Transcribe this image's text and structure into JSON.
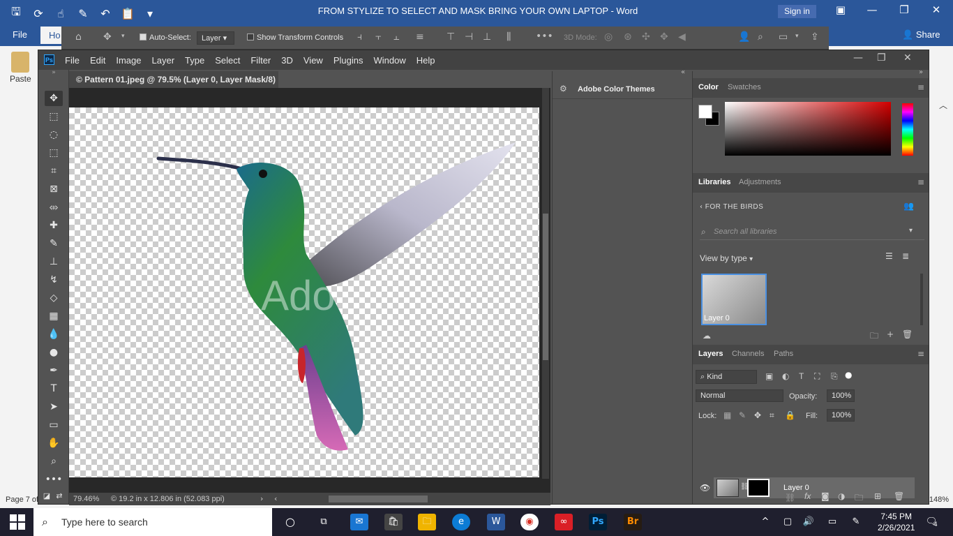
{
  "word": {
    "doc_title": "FROM STYLIZE TO SELECT AND MASK BRING YOUR OWN LAPTOP  -  Word",
    "sign_in": "Sign in",
    "file_tab": "File",
    "home_tab": "Ho",
    "share": "Share",
    "paste": "Paste",
    "page_status": "Page 7 of",
    "zoom": "148%"
  },
  "ps": {
    "menus": [
      "File",
      "Edit",
      "Image",
      "Layer",
      "Type",
      "Select",
      "Filter",
      "3D",
      "View",
      "Plugins",
      "Window",
      "Help"
    ],
    "logo": "Ps",
    "options": {
      "auto_select_label": "Auto-Select:",
      "auto_select_checked": true,
      "auto_select_target": "Layer",
      "show_transform_label": "Show Transform Controls",
      "show_transform_checked": false,
      "mode_3d_label": "3D Mode:"
    },
    "document": {
      "tab_title": "© Pattern 01.jpeg @ 79.5% (Layer 0, Layer Mask/8) *",
      "zoom": "79.46%",
      "size_info": "© 19.2 in x 12.806 in (52.083 ppi)",
      "watermark": "Ado"
    },
    "themes_panel": {
      "title": "Adobe Color Themes"
    },
    "color_panel": {
      "tabs": [
        "Color",
        "Swatches"
      ],
      "active": "Color",
      "fg_color": "#ffffff",
      "bg_color": "#000000",
      "hue_color": "#d40000"
    },
    "libraries_panel": {
      "tabs": [
        "Libraries",
        "Adjustments"
      ],
      "active": "Libraries",
      "library_name": "FOR THE BIRDS",
      "search_placeholder": "Search all libraries",
      "view_by": "View by type",
      "item_label": "Layer 0"
    },
    "layers_panel": {
      "tabs": [
        "Layers",
        "Channels",
        "Paths"
      ],
      "active": "Layers",
      "filter_kind": "Kind",
      "blend_mode": "Normal",
      "opacity_label": "Opacity:",
      "opacity_value": "100%",
      "lock_label": "Lock:",
      "fill_label": "Fill:",
      "fill_value": "100%",
      "layer_name": "Layer 0"
    }
  },
  "taskbar": {
    "search_placeholder": "Type here to search",
    "time": "7:45 PM",
    "date": "2/26/2021",
    "notification_count": "4"
  }
}
